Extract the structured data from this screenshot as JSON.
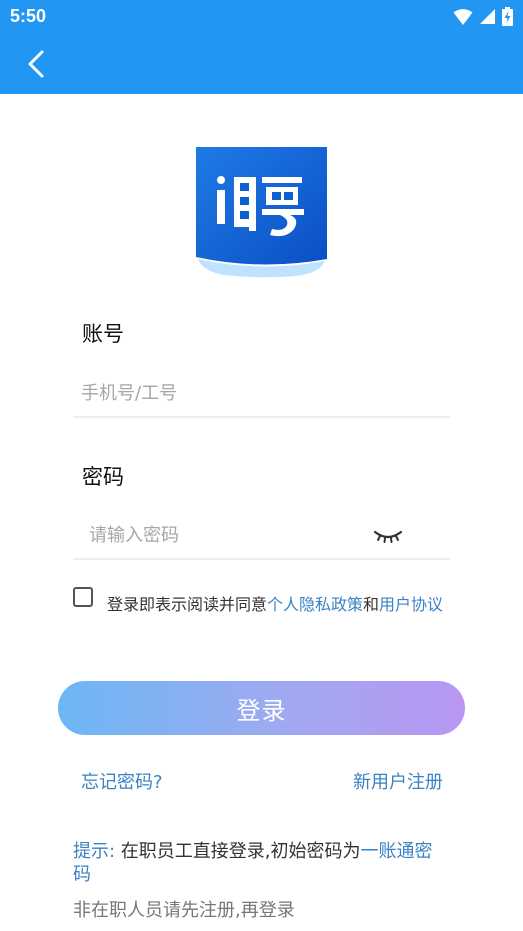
{
  "status_bar": {
    "time": "5:50",
    "icons": [
      "wifi-icon",
      "cell-signal-icon",
      "battery-charging-icon"
    ]
  },
  "app_bar": {
    "back_icon": "chevron-left-icon",
    "color": "#2196f3"
  },
  "logo": {
    "text": "i聘",
    "colors": {
      "primary": "#1565d8",
      "light": "#bfe2ff"
    }
  },
  "account": {
    "label": "账号",
    "value": "",
    "placeholder": "手机号/工号"
  },
  "password": {
    "label": "密码",
    "value": "",
    "placeholder": "请输入密码",
    "visibility_icon": "eye-closed-icon"
  },
  "agreement": {
    "checked": false,
    "text_prefix": "登录即表示阅读并同意",
    "privacy_link": "个人隐私政策",
    "conjunction": "和",
    "terms_link": "用户协议"
  },
  "login_button": {
    "label": "登录"
  },
  "links": {
    "forgot": "忘记密码?",
    "register": "新用户注册"
  },
  "tips": {
    "prefix": "提示:",
    "line1": " 在职员工直接登录,初始密码为",
    "highlight": "一账通密码",
    "line2": "非在职人员请先注册,再登录"
  },
  "colors": {
    "accent": "#2196f3",
    "link": "#3a82c4",
    "gradient_start": "#6cb7f4",
    "gradient_end": "#b996f2"
  }
}
